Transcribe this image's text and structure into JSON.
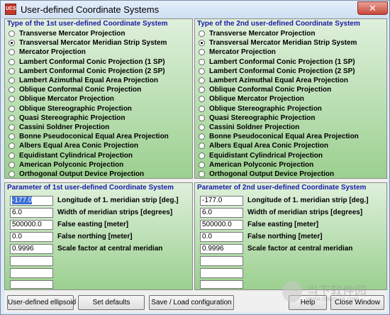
{
  "window": {
    "title": "User-defined Coordinate Systems",
    "close_symbol": "✕",
    "icon_text": "UCS"
  },
  "type1": {
    "title": "Type of the 1st user-defined Coordinate System",
    "options": [
      "Transverse Mercator Projection",
      "Transversal Mercator Meridian Strip System",
      "Mercator Projection",
      "Lambert Conformal Conic Projection (1 SP)",
      "Lambert Conformal Conic Projection (2 SP)",
      "Lambert Azimuthal Equal Area Projection",
      "Oblique Conformal Conic Projection",
      "Oblique Mercator Projection",
      "Oblique Stereographic Projection",
      "Quasi Stereographic Projection",
      "Cassini Soldner Projection",
      "Bonne Pseudoconical Equal Area Projection",
      "Albers Equal Area Conic Projection",
      "Equidistant Cylindrical Projection",
      "American Polyconic Projection",
      "Orthogonal Output Device Projection"
    ],
    "selected_index": 1
  },
  "type2": {
    "title": "Type of the 2nd user-defined Coordinate System",
    "options": [
      "Transverse Mercator Projection",
      "Transversal Mercator Meridian Strip System",
      "Mercator Projection",
      "Lambert Conformal Conic Projection (1 SP)",
      "Lambert Conformal Conic Projection (2 SP)",
      "Lambert Azimuthal Equal Area Projection",
      "Oblique Conformal Conic Projection",
      "Oblique Mercator Projection",
      "Oblique Stereographic Projection",
      "Quasi Stereographic Projection",
      "Cassini Soldner Projection",
      "Bonne Pseudoconical Equal Area Projection",
      "Albers Equal Area Conic Projection",
      "Equidistant Cylindrical Projection",
      "American Polyconic Projection",
      "Orthogonal Output Device Projection"
    ],
    "selected_index": 1
  },
  "param1": {
    "title": "Parameter of 1st user-defined Coordinate System",
    "rows": [
      {
        "value": "-177.0",
        "label": "Longitude of 1. meridian strip [deg.]"
      },
      {
        "value": "6.0",
        "label": "Width of meridian strips [degrees]"
      },
      {
        "value": "500000.0",
        "label": "False easting [meter]"
      },
      {
        "value": "0.0",
        "label": "False northing [meter]"
      },
      {
        "value": "0.9996",
        "label": "Scale factor at central meridian"
      }
    ]
  },
  "param2": {
    "title": "Parameter of 2nd user-defined Coordinate System",
    "rows": [
      {
        "value": "-177.0",
        "label": "Longitude of 1. meridian strip [deg.]"
      },
      {
        "value": "6.0",
        "label": "Width of meridian strips [degrees]"
      },
      {
        "value": "500000.0",
        "label": "False easting [meter]"
      },
      {
        "value": "0.0",
        "label": "False northing [meter]"
      },
      {
        "value": "0.9996",
        "label": "Scale factor at central meridian"
      }
    ]
  },
  "buttons": {
    "ellipsoid": "User-defined ellipsoid",
    "defaults": "Set defaults",
    "save_load": "Save / Load configuration",
    "help": "Help",
    "close": "Close Window"
  },
  "watermark": {
    "text": "当下软件园",
    "url": "www.downxia.com"
  },
  "colors": {
    "panel_title": "#1a1aa8",
    "panel_top": "#dff0dc",
    "panel_bottom": "#9bd08f"
  }
}
